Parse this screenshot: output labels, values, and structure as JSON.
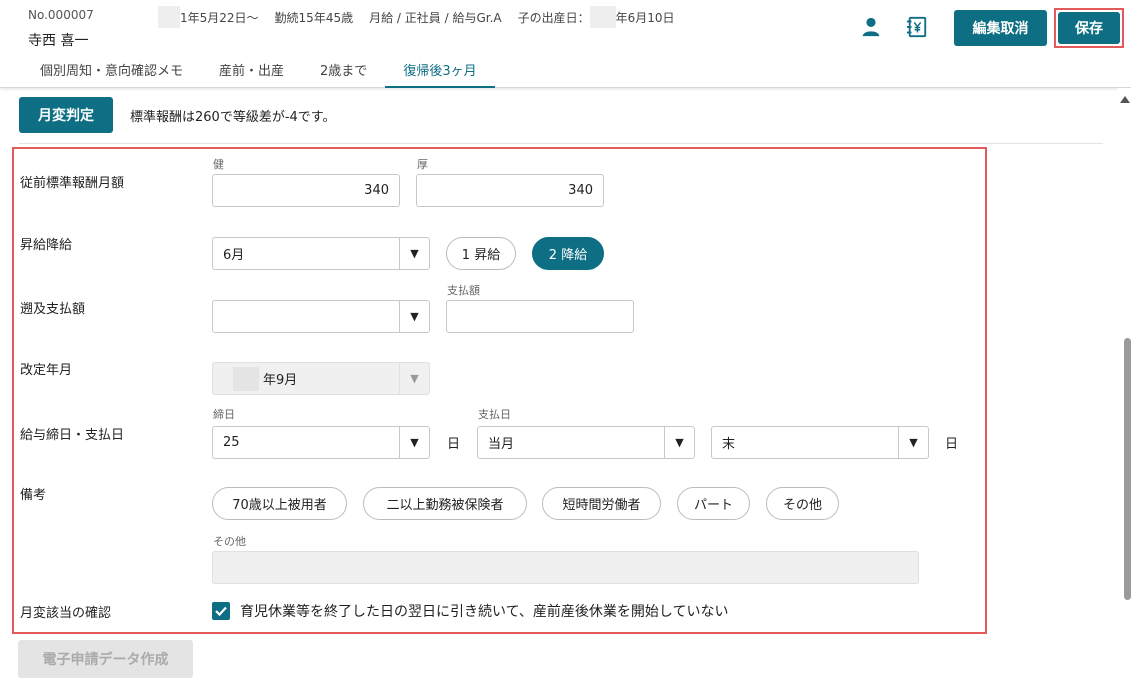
{
  "header": {
    "employee_no": "No.000007",
    "employee_name": "寺西 喜一",
    "info_date": "1年5月22日～",
    "info_tenure": "勤続15年45歳",
    "info_type": "月給 / 正社員 / 給与Gr.A",
    "info_birth_label": "子の出産日：",
    "info_birth_date": "年6月10日",
    "cancel_label": "編集取消",
    "save_label": "保存"
  },
  "tabs": [
    {
      "label": "個別周知・意向確認メモ"
    },
    {
      "label": "産前・出産"
    },
    {
      "label": "2歳まで"
    },
    {
      "label": "復帰後3ヶ月"
    }
  ],
  "judge": {
    "button_label": "月変判定",
    "message": "標準報酬は260で等級差が-4です。"
  },
  "form": {
    "prev_standard": {
      "label": "従前標準報酬月額",
      "health_label": "健",
      "health_value": "340",
      "pension_label": "厚",
      "pension_value": "340"
    },
    "raise": {
      "label": "昇給降給",
      "month_value": "6月",
      "opt1": "1 昇給",
      "opt2": "2 降給"
    },
    "retro": {
      "label": "遡及支払額",
      "select_value": "",
      "amount_label": "支払額",
      "amount_value": ""
    },
    "revision": {
      "label": "改定年月",
      "value": "年9月"
    },
    "payday": {
      "label": "給与締日・支払日",
      "close_label": "締日",
      "close_value": "25",
      "day_unit": "日",
      "pay_label": "支払日",
      "pay_month_value": "当月",
      "pay_day_value": "末",
      "pay_unit": "日"
    },
    "notes": {
      "label": "備考",
      "chips": [
        "70歳以上被用者",
        "二以上勤務被保険者",
        "短時間労働者",
        "パート",
        "その他"
      ],
      "other_label": "その他",
      "other_value": ""
    },
    "confirm": {
      "label": "月変該当の確認",
      "check_text": "育児休業等を終了した日の翌日に引き続いて、産前産後休業を開始していない"
    }
  },
  "footer": {
    "edoc_label": "電子申請データ作成"
  },
  "colors": {
    "accent": "#0d6e84",
    "highlight": "#e25a5a"
  }
}
